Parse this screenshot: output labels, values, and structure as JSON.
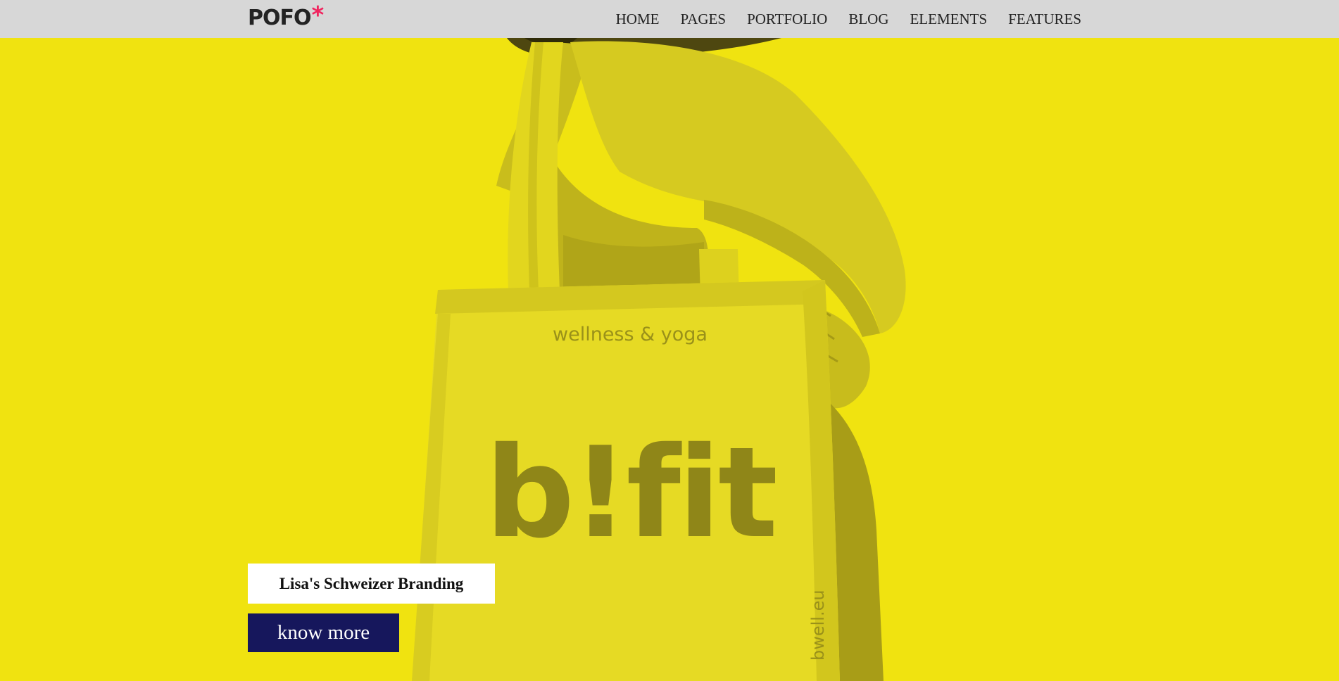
{
  "brand": {
    "name": "POFO",
    "mark": "*",
    "accent": "#f0255f"
  },
  "nav": {
    "items": [
      {
        "label": "HOME"
      },
      {
        "label": "PAGES"
      },
      {
        "label": "PORTFOLIO"
      },
      {
        "label": "BLOG"
      },
      {
        "label": "ELEMENTS"
      },
      {
        "label": "FEATURES"
      }
    ]
  },
  "hero": {
    "background": "#f0e310",
    "bag": {
      "tagline": "wellness & yoga",
      "logo_text": "b!fit",
      "side_text": "bwell.eu"
    },
    "caption": "Lisa's Schweizer Branding",
    "cta_label": "know more",
    "cta_color": "#16175c"
  }
}
